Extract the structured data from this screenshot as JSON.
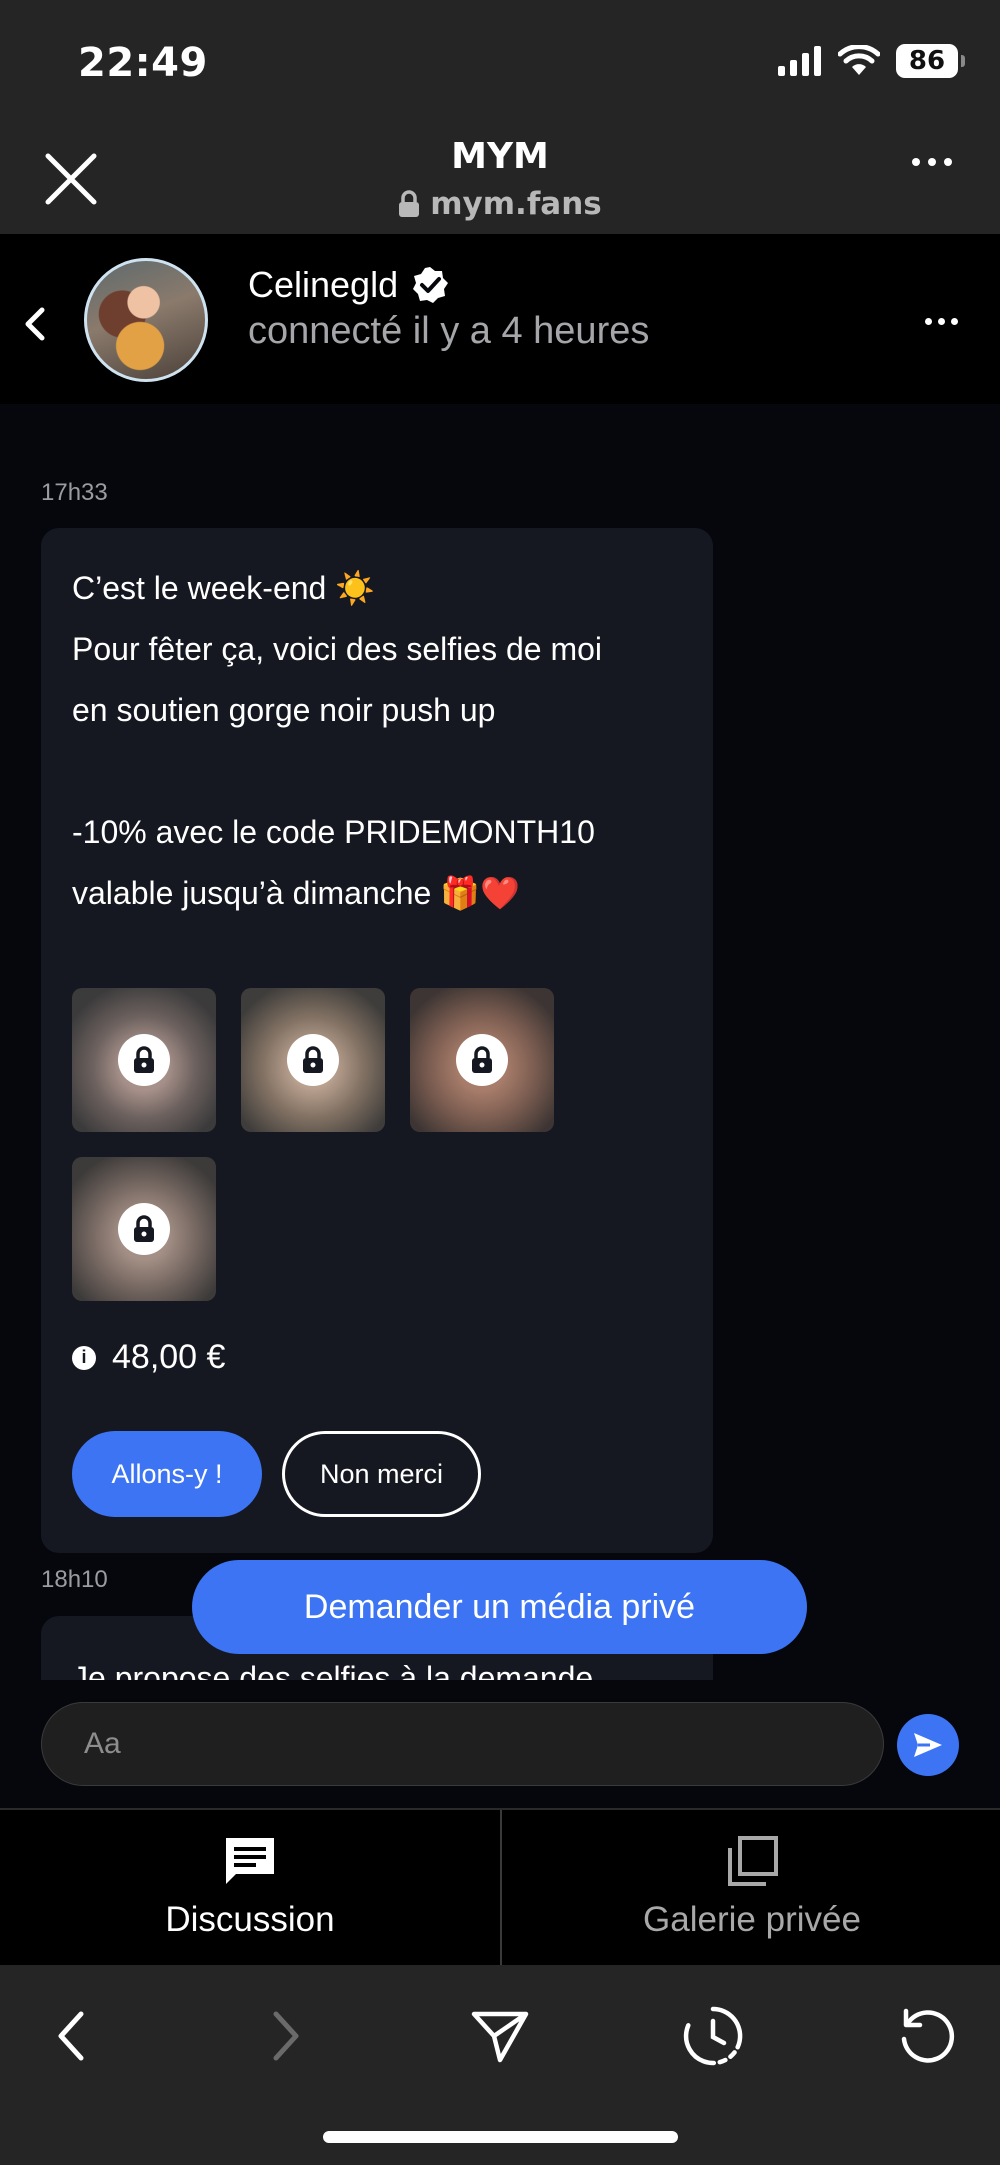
{
  "status_bar": {
    "time": "22:49",
    "battery": "86"
  },
  "browser": {
    "title": "MYM",
    "url": "mym.fans"
  },
  "chat": {
    "name": "Celinegld",
    "status": "connecté il y a 4 heures"
  },
  "messages": [
    {
      "time": "17h33",
      "lines": [
        "C’est le week-end ☀️",
        "Pour fêter ça, voici des selfies de moi",
        "en soutien gorge noir push up",
        "",
        "-10% avec le code PRIDEMONTH10",
        "valable jusqu’à dimanche 🎁❤️"
      ],
      "locked_media_count": 4,
      "price": "48,00 €",
      "accept_label": "Allons-y !",
      "decline_label": "Non merci"
    },
    {
      "time": "18h10",
      "preview_text": "Je propose des selfies à la demande"
    }
  ],
  "request_button": "Demander un média privé",
  "composer": {
    "placeholder": "Aa"
  },
  "tabs": [
    {
      "label": "Discussion",
      "icon": "chat-icon",
      "active": true
    },
    {
      "label": "Galerie privée",
      "icon": "gallery-icon",
      "active": false
    }
  ],
  "colors": {
    "accent": "#3d74f4",
    "bubble": "#151821",
    "browser_chrome": "#252525"
  }
}
